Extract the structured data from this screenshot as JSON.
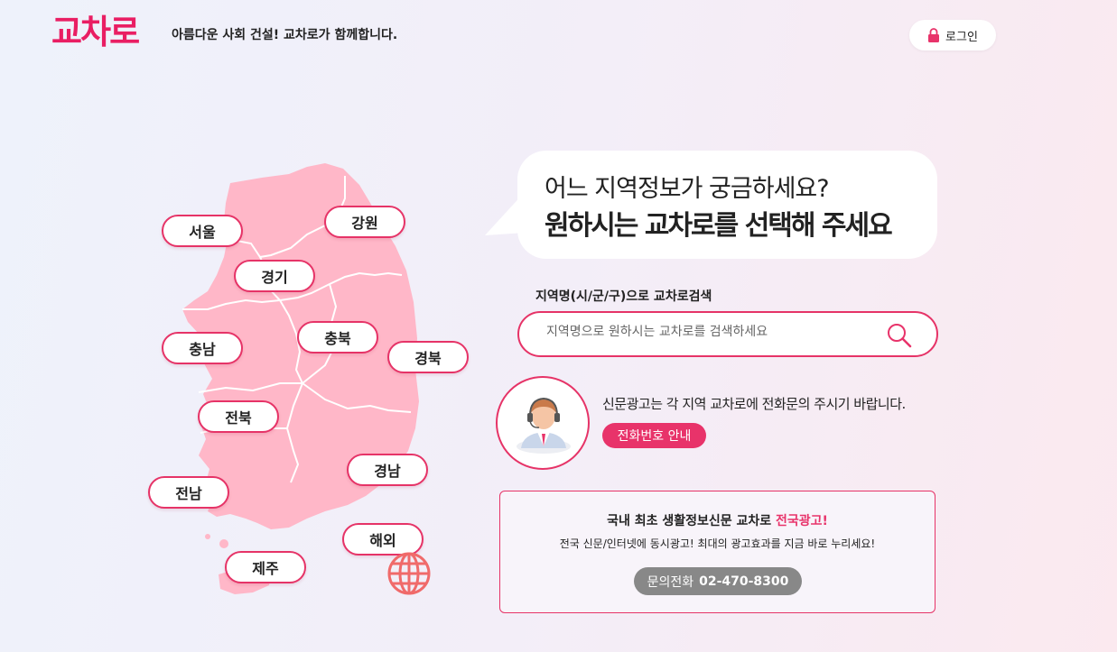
{
  "header": {
    "logo": "교차로",
    "tagline": "아름다운 사회 건설! 교차로가 함께합니다.",
    "login_label": "로그인"
  },
  "regions": [
    {
      "name": "서울"
    },
    {
      "name": "강원"
    },
    {
      "name": "경기"
    },
    {
      "name": "충남"
    },
    {
      "name": "충북"
    },
    {
      "name": "경북"
    },
    {
      "name": "전북"
    },
    {
      "name": "경남"
    },
    {
      "name": "전남"
    },
    {
      "name": "해외"
    },
    {
      "name": "제주"
    }
  ],
  "bubble": {
    "line1": "어느 지역정보가 궁금하세요?",
    "line2": "원하시는 교차로를 선택해 주세요"
  },
  "search": {
    "label": "지역명(시/군/구)으로 교차로검색",
    "placeholder": "지역명으로 원하시는 교차로를 검색하세요"
  },
  "notice": {
    "text": "신문광고는 각 지역 교차로에 전화문의 주시기 바랍니다.",
    "button_label": "전화번호 안내"
  },
  "ad": {
    "title_prefix": "국내 최초 생활정보신문 교차로 ",
    "title_accent": "전국광고!",
    "subtitle": "전국 신문/인터넷에 동시광고! 최대의 광고효과를 지금 바로 누리세요!",
    "phone_label": "문의전화",
    "phone_number": "02-470-8300"
  },
  "colors": {
    "accent": "#e8336a",
    "map_fill": "#ffb7c8",
    "gray_button": "#888888"
  }
}
